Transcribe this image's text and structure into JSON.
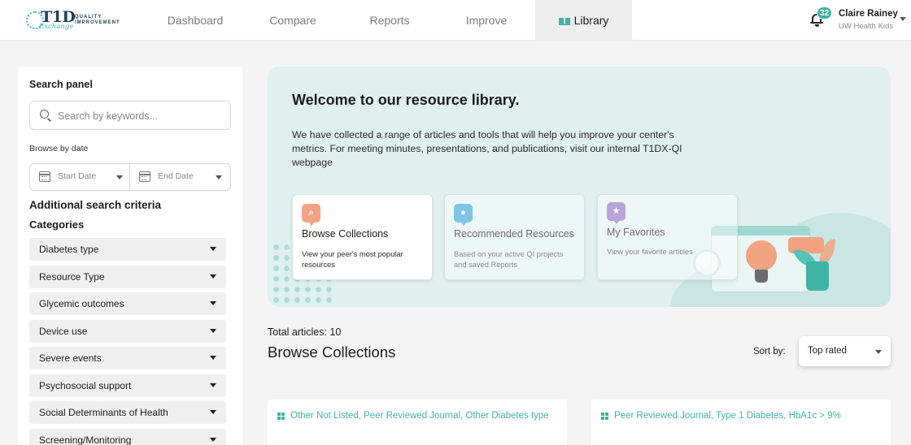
{
  "brand": {
    "logo_big": "T1D",
    "logo_script": "Exchange",
    "logo_sub_1": "QUALITY",
    "logo_sub_2": "IMPROVEMENT"
  },
  "nav": {
    "items": [
      {
        "label": "Dashboard"
      },
      {
        "label": "Compare"
      },
      {
        "label": "Reports"
      },
      {
        "label": "Improve"
      },
      {
        "label": "Library"
      }
    ],
    "active": "Library"
  },
  "user": {
    "notifications": "32",
    "name": "Claire Rainey",
    "org": "UW Health Kids"
  },
  "search_panel": {
    "title": "Search panel",
    "search_placeholder": "Search by keywords...",
    "date_label": "Browse by date",
    "start_date": "Start Date",
    "end_date": "End Date",
    "criteria_title": "Additional search criteria",
    "categories_title": "Categories",
    "categories": [
      "Diabetes type",
      "Resource Type",
      "Glycemic outcomes",
      "Device use",
      "Severe events",
      "Psychosocial support",
      "Social Determinants of Health",
      "Screening/Monitoring"
    ]
  },
  "hero": {
    "title": "Welcome to our resource library.",
    "description": "We have collected a range of articles and tools that will help you improve your center's metrics. For meeting minutes, presentations, and publications, visit our internal T1DX-QI webpage",
    "cards": [
      {
        "title": "Browse Collections",
        "desc": "View your peer's most popular resources",
        "icon": "search-doc-icon",
        "color": "#f2a382"
      },
      {
        "title": "Recommended Resources",
        "desc": "Based on your active QI projects and saved Reports",
        "icon": "person-doc-icon",
        "color": "#7fc3e8"
      },
      {
        "title": "My Favorites",
        "desc": "View your favorite articles",
        "icon": "star-doc-icon",
        "color": "#b7a6d8"
      }
    ]
  },
  "main": {
    "total_articles": "Total articles: 10",
    "section_title": "Browse Collections",
    "sort_label": "Sort by:",
    "sort_value": "Top rated",
    "articles": [
      {
        "tags": "Other Not Listed, Peer Reviewed Journal, Other Diabetes type"
      },
      {
        "tags": "Peer Reviewed Journal, Type 1 Diabetes, HbA1c > 9%"
      }
    ]
  },
  "colors": {
    "accent": "#3fb3a5",
    "hero_bg": "#dff0ee",
    "page_bg": "#f4f4f4"
  }
}
